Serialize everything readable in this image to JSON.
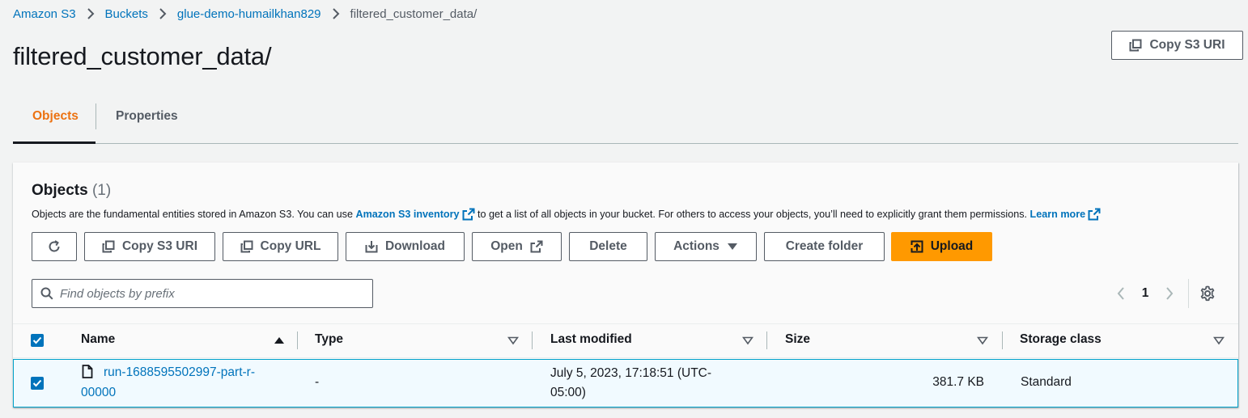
{
  "breadcrumb": {
    "items": [
      "Amazon S3",
      "Buckets",
      "glue-demo-humailkhan829"
    ],
    "current": "filtered_customer_data/"
  },
  "page_title": "filtered_customer_data/",
  "header_copy_uri_label": "Copy S3 URI",
  "tabs": [
    {
      "label": "Objects",
      "active": true
    },
    {
      "label": "Properties",
      "active": false
    }
  ],
  "objects_panel": {
    "title": "Objects",
    "count": "(1)",
    "description_part1": "Objects are the fundamental entities stored in Amazon S3. You can use",
    "inventory_link": "Amazon S3 inventory",
    "description_part2": "to get a list of all objects in your bucket. For others to access your objects, you’ll need to explicitly grant them permissions.",
    "learn_more": "Learn more"
  },
  "toolbar": {
    "copy_s3_uri": "Copy S3 URI",
    "copy_url": "Copy URL",
    "download": "Download",
    "open": "Open",
    "delete": "Delete",
    "actions": "Actions",
    "create_folder": "Create folder",
    "upload": "Upload"
  },
  "search": {
    "placeholder": "Find objects by prefix",
    "value": ""
  },
  "pagination": {
    "current_page": "1"
  },
  "table": {
    "columns": [
      "Name",
      "Type",
      "Last modified",
      "Size",
      "Storage class"
    ],
    "rows": [
      {
        "name_line1": "run-1688595502997-part-r-",
        "name_line2": "00000",
        "type": "-",
        "last_modified_line1": "July 5, 2023, 17:18:51 (UTC-",
        "last_modified_line2": "05:00)",
        "size": "381.7 KB",
        "storage_class": "Standard",
        "selected": true
      }
    ]
  },
  "colors": {
    "link": "#0073bb",
    "accent_tab": "#ec7211",
    "primary_button": "#ff9900",
    "text": "#16191f",
    "secondary_text": "#545b64",
    "row_selected_bg": "#f1faff",
    "row_selected_border": "#00a1c9"
  },
  "icons": {
    "breadcrumb_separator": "chevron-right-icon",
    "copy": "copy-icon",
    "refresh": "refresh-icon",
    "download": "download-icon",
    "external": "external-link-icon",
    "caret": "caret-down-icon",
    "upload": "upload-icon",
    "search": "search-icon",
    "settings": "gear-icon",
    "file": "file-icon"
  }
}
